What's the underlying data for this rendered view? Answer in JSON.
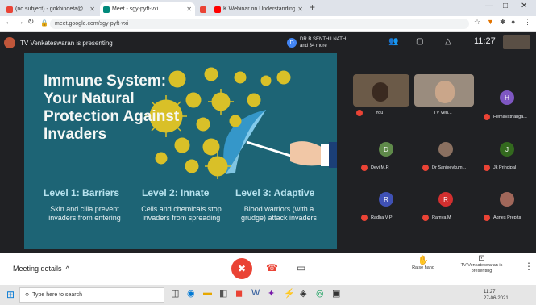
{
  "browser": {
    "tabs": [
      {
        "title": "(no subject) - gokhindeta@..",
        "color": "#ea4335"
      },
      {
        "title": "Meet - sgy-pyft-vxi",
        "color": "#00897b"
      },
      {
        "title": "",
        "color": "#ea4335"
      },
      {
        "title": "K Webinar on Understanding C",
        "color": "#ff0000"
      }
    ],
    "new_tab": "+",
    "url": "meet.google.com/sgy-pyft-vxi",
    "window_controls": [
      "—",
      "□",
      "✕"
    ]
  },
  "meet": {
    "presenter_text": "TV Venkateswaran is presenting",
    "attendee_chip": {
      "initial": "D",
      "line1": "DR B SENTHILNATH...",
      "line2": "and 34 more"
    },
    "clock": "11:27",
    "slide": {
      "title": "Immune System: Your Natural Protection Against Invaders",
      "levels": [
        {
          "heading": "Level 1: Barriers",
          "desc": "Skin and cilia prevent invaders from entering"
        },
        {
          "heading": "Level 2: Innate",
          "desc": "Cells and chemicals stop invaders from spreading"
        },
        {
          "heading": "Level 3: Adaptive",
          "desc": "Blood warriors (with a grudge) attack invaders"
        }
      ]
    },
    "participants": [
      {
        "name": "You",
        "initial": "",
        "color": "#5a4a3a",
        "video": true
      },
      {
        "name": "TV Ven...",
        "initial": "",
        "color": "#8a7a6a",
        "video": true
      },
      {
        "name": "Hemavathanga...",
        "initial": "H",
        "color": "#7e57c2",
        "video": false
      },
      {
        "name": "Devi M.R",
        "initial": "D",
        "color": "#5f8a4a",
        "video": false
      },
      {
        "name": "Dr Sanjeevkum...",
        "initial": "",
        "color": "#8a7060",
        "video": false
      },
      {
        "name": "Jk Principal",
        "initial": "J",
        "color": "#33691e",
        "video": false
      },
      {
        "name": "Radha V P",
        "initial": "R",
        "color": "#3f51b5",
        "video": false
      },
      {
        "name": "Ramya M",
        "initial": "R",
        "color": "#d32f2f",
        "video": false
      },
      {
        "name": "Agnes Prepita",
        "initial": "",
        "color": "#a0675a",
        "video": false
      }
    ],
    "bottom": {
      "meeting_details": "Meeting details",
      "raise_hand": "Raise hand",
      "presenting_label": "TV Venkateswaran is presenting"
    }
  },
  "taskbar": {
    "search_placeholder": "Type here to search",
    "date": "11:27",
    "date2": "27-06-2021"
  }
}
